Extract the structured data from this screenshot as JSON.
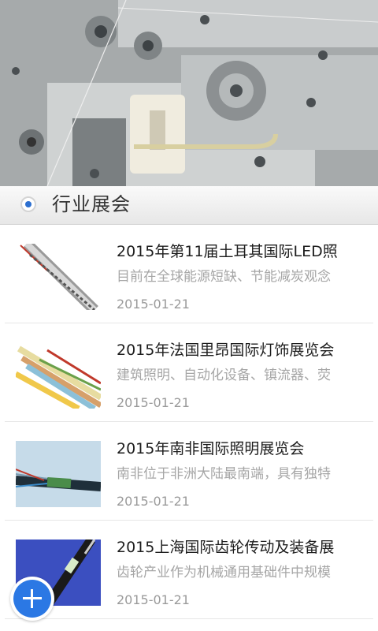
{
  "banner": {
    "image": "machinery-photo"
  },
  "section": {
    "title": "行业展会"
  },
  "items": [
    {
      "title": "2015年第11届土耳其国际LED照",
      "summary": "目前在全球能源短缺、节能减炭观念",
      "date": "2015-01-21",
      "thumb": "coaxial-cable-thumbnail"
    },
    {
      "title": "2015年法国里昂国际灯饰展览会",
      "summary": "建筑照明、自动化设备、镇流器、荧",
      "date": "2015-01-21",
      "thumb": "colored-wires-thumbnail"
    },
    {
      "title": "2015年南非国际照明展览会",
      "summary": "南非位于非洲大陆最南端，具有独特",
      "date": "2015-01-21",
      "thumb": "fiber-cable-thumbnail"
    },
    {
      "title": "2015上海国际齿轮传动及装备展",
      "summary": "齿轮产业作为机械通用基础件中规模",
      "date": "2015-01-21",
      "thumb": "blue-cable-thumbnail"
    }
  ],
  "fab": {
    "icon": "plus-icon"
  }
}
